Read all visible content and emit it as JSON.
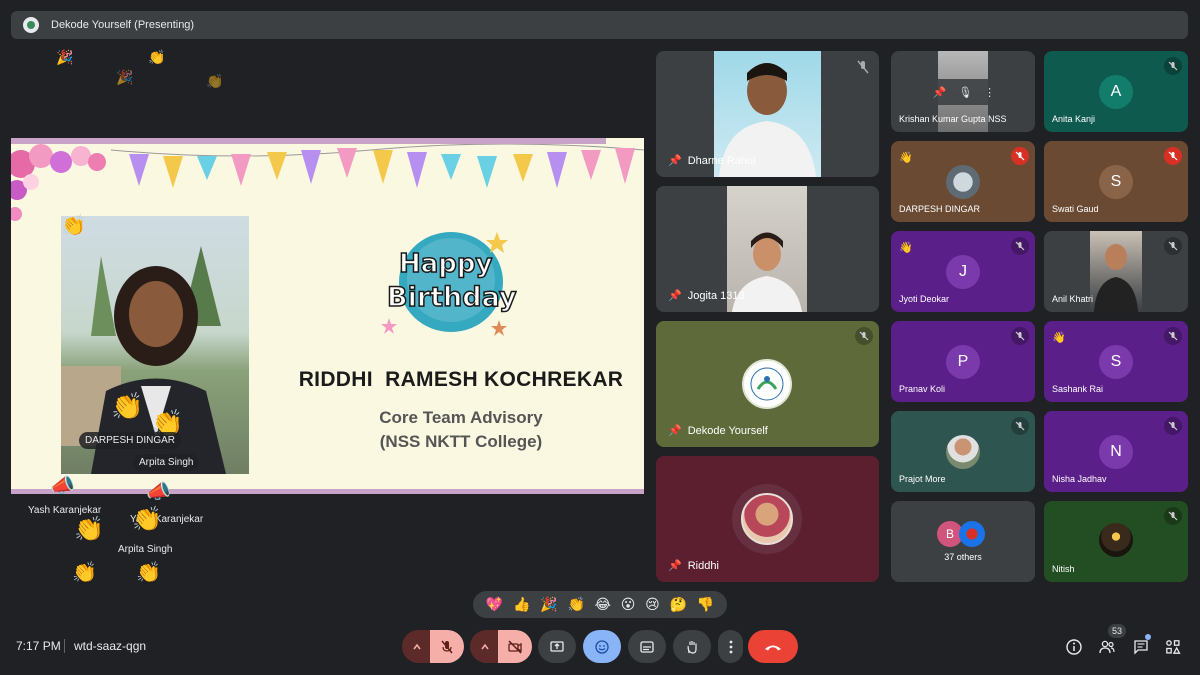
{
  "presentation_bar": {
    "title": "Dekode Yourself (Presenting)"
  },
  "slide": {
    "heading_line1": "Happy",
    "heading_line2": "Birthday",
    "person_name": "RIDDHI  RAMESH KOCHREKAR",
    "role": "Core Team Advisory",
    "college": "(NSS NKTT College)",
    "overlay_names": [
      "DARPESH DINGAR",
      "Arpita Singh"
    ]
  },
  "floating_reactions": [
    {
      "name": "Yash Karanjekar"
    },
    {
      "name": "Yash Karanjekar"
    },
    {
      "name": "Arpita Singh"
    }
  ],
  "tiles": {
    "large": [
      {
        "name": "Dharne Rahul",
        "pinned": true,
        "muted": true
      },
      {
        "name": "Jogita 1313",
        "pinned": true,
        "muted": false
      },
      {
        "name": "Dekode Yourself",
        "pinned": true,
        "muted": false
      },
      {
        "name": "Riddhi",
        "pinned": true,
        "muted": false
      }
    ],
    "small": [
      {
        "name": "Krishan Kumar Gupta NSS",
        "initial": ""
      },
      {
        "name": "Anita Kanji",
        "initial": "A"
      },
      {
        "name": "DARPESH DINGAR",
        "initial": ""
      },
      {
        "name": "Swati Gaud",
        "initial": "S"
      },
      {
        "name": "Jyoti Deokar",
        "initial": "J"
      },
      {
        "name": "Anil Khatri",
        "initial": ""
      },
      {
        "name": "Pranav Koli",
        "initial": "P"
      },
      {
        "name": "Sashank Rai",
        "initial": "S"
      },
      {
        "name": "Prajot More",
        "initial": ""
      },
      {
        "name": "Nisha Jadhav",
        "initial": "N"
      },
      {
        "name": "37 others",
        "initial": "B"
      },
      {
        "name": "Nitish",
        "initial": ""
      }
    ]
  },
  "reaction_bar": [
    "💖",
    "👍",
    "🎉",
    "👏",
    "😂",
    "😮",
    "😢",
    "🤔",
    "👎"
  ],
  "bottom_bar": {
    "time": "7:17 PM",
    "meeting_code": "wtd-saaz-qgn",
    "participant_count": "53"
  },
  "colors": {
    "background": "#202124",
    "end_call": "#ea4335",
    "muted_control": "#f6aea9",
    "active_control": "#8ab4f8"
  }
}
